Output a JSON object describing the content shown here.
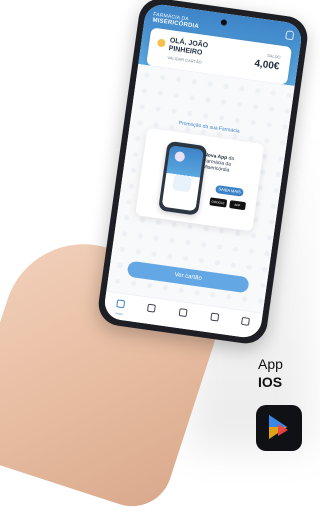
{
  "app": {
    "logo_line1": "FARMÁCIA DA",
    "logo_line2": "MISERICÓRDIA"
  },
  "user_card": {
    "greeting_line1": "OLÁ, JOÃO",
    "greeting_line2": "PINHEIRO",
    "subtext": "VALIDAR CARTÃO",
    "balance_label": "SALDO",
    "balance_value": "4,00€"
  },
  "promo": {
    "section_title": "Promoção da sua Farmácia",
    "headline_bold": "Nova App",
    "headline_rest": " da Farmácia da Misericórdia",
    "cta_label": "SAIBA MAIS",
    "store_google": "GOOGLE",
    "store_apple": "APP STORE"
  },
  "actions": {
    "primary_button": "Ver cartão"
  },
  "tabs": [
    {
      "label": "Início",
      "active": true,
      "icon": "home-icon"
    },
    {
      "label": "",
      "active": false,
      "icon": "tag-icon"
    },
    {
      "label": "",
      "active": false,
      "icon": "badge-icon"
    },
    {
      "label": "",
      "active": false,
      "icon": "gift-icon"
    },
    {
      "label": "",
      "active": false,
      "icon": "menu-icon"
    }
  ],
  "right_text": {
    "line1": "App",
    "line2": "IOS"
  },
  "colors": {
    "brand_blue": "#3d84c7",
    "accent_gold": "#f3c14a",
    "dark": "#1d1f24"
  }
}
